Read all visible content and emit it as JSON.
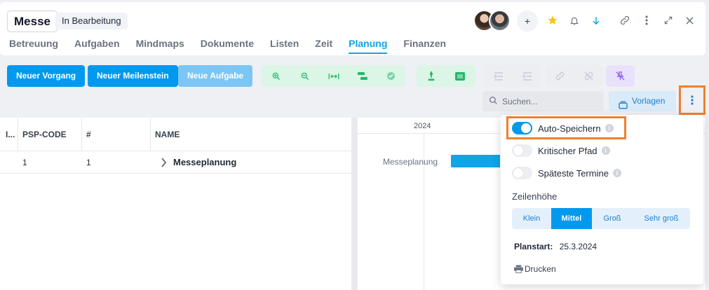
{
  "header": {
    "title": "Messe",
    "status": "In Bearbeitung",
    "plus_label": "+"
  },
  "tabs": [
    {
      "label": "Betreuung",
      "active": false
    },
    {
      "label": "Aufgaben",
      "active": false
    },
    {
      "label": "Mindmaps",
      "active": false
    },
    {
      "label": "Dokumente",
      "active": false
    },
    {
      "label": "Listen",
      "active": false
    },
    {
      "label": "Zeit",
      "active": false
    },
    {
      "label": "Planung",
      "active": true
    },
    {
      "label": "Finanzen",
      "active": false
    }
  ],
  "toolbar": {
    "new_process": "Neuer Vorgang",
    "new_milestone": "Neuer Meilenstein",
    "new_task": "Neue Aufgabe",
    "search_placeholder": "Suchen...",
    "templates": "Vorlagen"
  },
  "table": {
    "headers": [
      "I...",
      "PSP-CODE",
      "#",
      "NAME"
    ],
    "rows": [
      {
        "psp": "1",
        "num": "1",
        "name": "Messeplanung"
      }
    ]
  },
  "gantt": {
    "year": "2024",
    "bar_label": "Messeplanung"
  },
  "dropdown": {
    "auto_save": {
      "label": "Auto-Speichern",
      "on": true
    },
    "critical_path": {
      "label": "Kritischer Pfad",
      "on": false
    },
    "latest_dates": {
      "label": "Späteste Termine",
      "on": false
    },
    "row_height_label": "Zeilenhöhe",
    "row_heights": [
      "Klein",
      "Mittel",
      "Groß",
      "Sehr groß"
    ],
    "row_height_selected": "Mittel",
    "plan_start_label": "Planstart:",
    "plan_start_value": "25.3.2024",
    "print_label": "Drucken",
    "info_glyph": "i"
  },
  "colors": {
    "accent": "#0099ee",
    "highlight": "#f07f2c"
  }
}
